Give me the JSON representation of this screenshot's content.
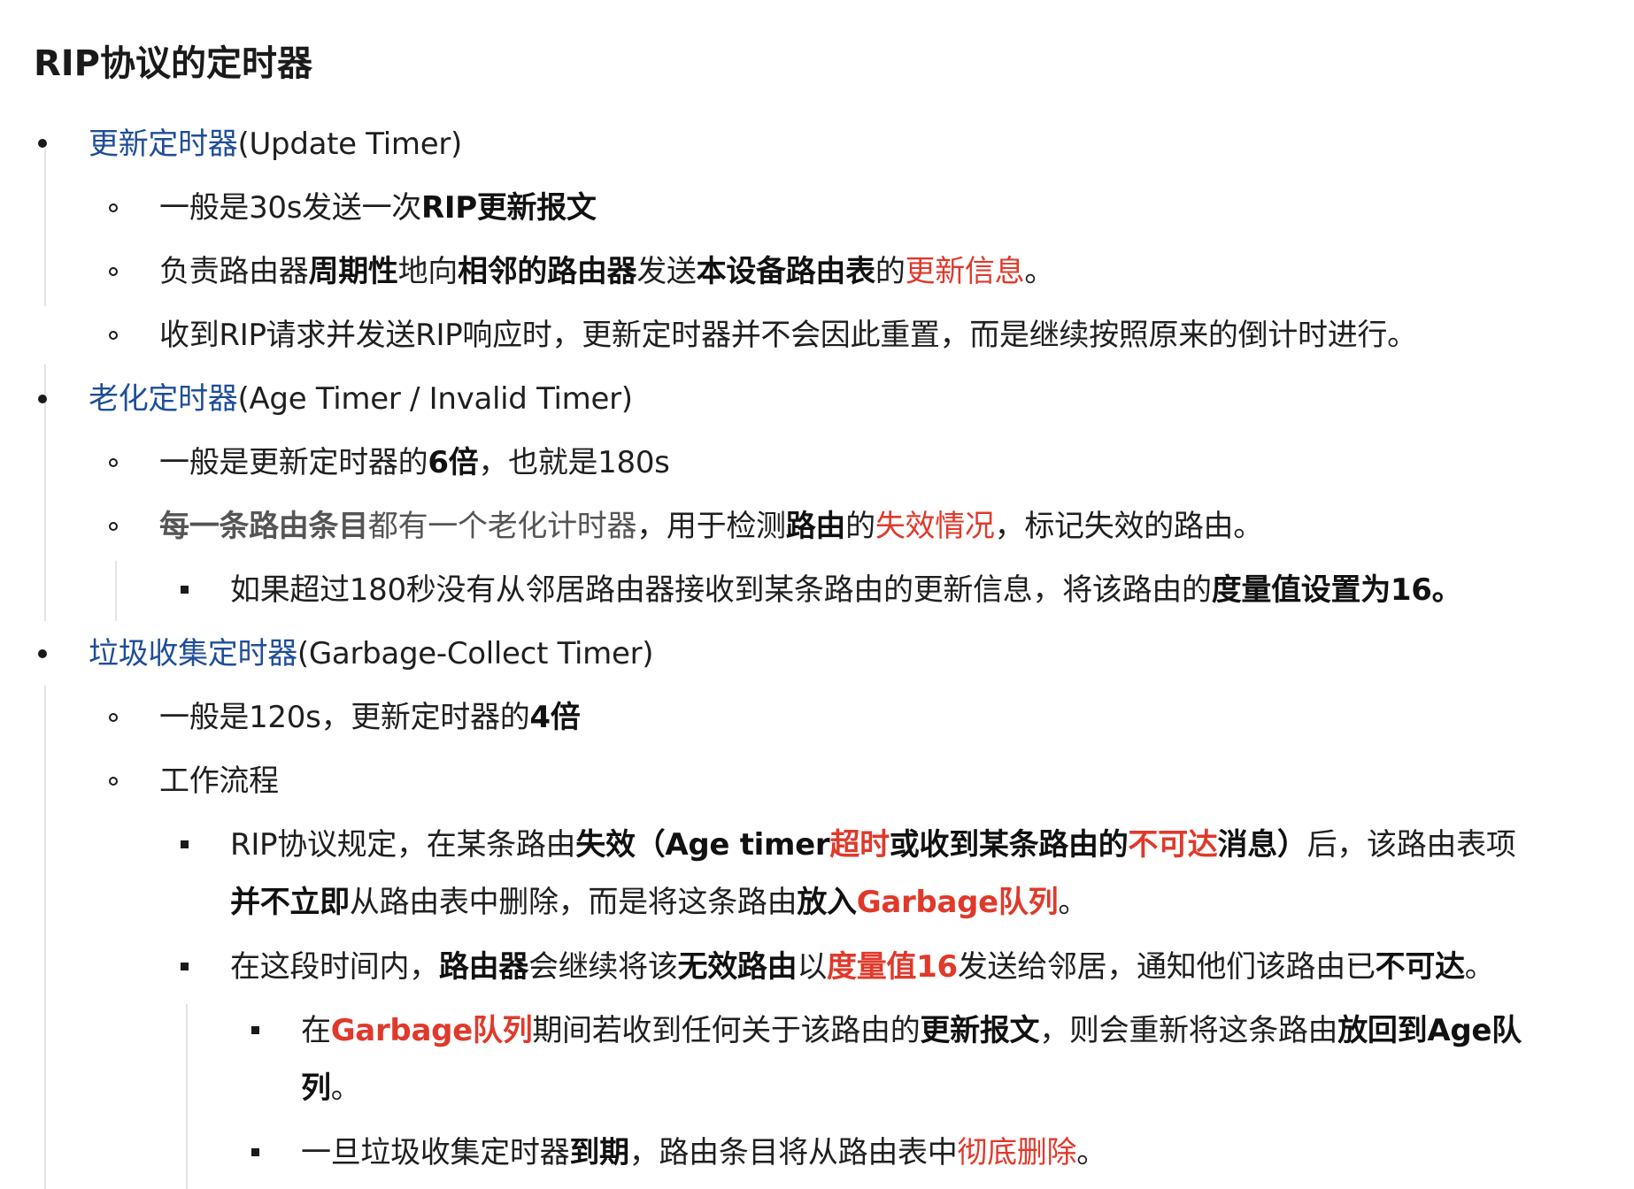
{
  "title": "RIP协议的定时器",
  "update": {
    "heading": "更新定时器",
    "heading_en": "(Update Timer)",
    "items": [
      {
        "a": "一般是30s发送一次",
        "b": "RIP更新报文"
      },
      {
        "a": "负责路由器",
        "b": "周期性",
        "c": "地向",
        "d": "相邻的路由器",
        "e": "发送",
        "f": "本设备路由表",
        "g": "的",
        "h": "更新信息",
        "i": "。"
      },
      {
        "a": "收到RIP请求并发送RIP响应时，更新定时器并不会因此重置，而是继续按照原来的倒计时进行。"
      }
    ]
  },
  "age": {
    "heading": "老化定时器",
    "heading_en": "(Age Timer / Invalid Timer)",
    "items": [
      {
        "a": "一般是更新定时器的",
        "b": "6倍",
        "c": "，也就是180s"
      },
      {
        "a": "每一条路由条目",
        "b": "都有一个老化计时器",
        "c": "，用于检测",
        "d": "路由",
        "e": "的",
        "f": "失效情况",
        "g": "，标记失效的路由。"
      }
    ],
    "sub": {
      "a": "如果超过180秒没有从邻居路由器接收到某条路由的更新信息，将该路由的",
      "b": "度量值设置为16。"
    }
  },
  "garbage": {
    "heading": "垃圾收集定时器",
    "heading_en": "(Garbage-Collect Timer)",
    "items": [
      {
        "a": "一般是120s，更新定时器的",
        "b": "4倍"
      },
      {
        "a": "工作流程"
      }
    ],
    "flow": [
      {
        "line1": {
          "a": "RIP协议规定，在某条路由",
          "b": "失效",
          "c": "（Age timer",
          "d": "超时",
          "e": "或收到某条路由的",
          "f": "不可达",
          "g": "消息）",
          "h": "后，该路由表项"
        },
        "line2": {
          "a": "并不立即",
          "b": "从路由表中删除，而是将这条路由",
          "c": "放入",
          "d": "Garbage队列",
          "e": "。"
        }
      },
      {
        "a": "在这段时间内，",
        "b": "路由器",
        "c": "会继续将该",
        "d": "无效路由",
        "e": "以",
        "f": "度量值16",
        "g": "发送给邻居，通知他们该路由已",
        "h": "不可达",
        "i": "。"
      }
    ],
    "flow_sub": [
      {
        "line1": {
          "a": "在",
          "b": "Garbage队列",
          "c": "期间若收到任何关于该路由的",
          "d": "更新报文",
          "e": "，则会重新将这条路由",
          "f": "放回到Age队"
        },
        "line2": {
          "a": "列",
          "b": "。"
        }
      },
      {
        "a": "一旦垃圾收集定时器",
        "b": "到期",
        "c": "，路由条目将从路由表中",
        "d": "彻底删除",
        "e": "。"
      }
    ]
  }
}
